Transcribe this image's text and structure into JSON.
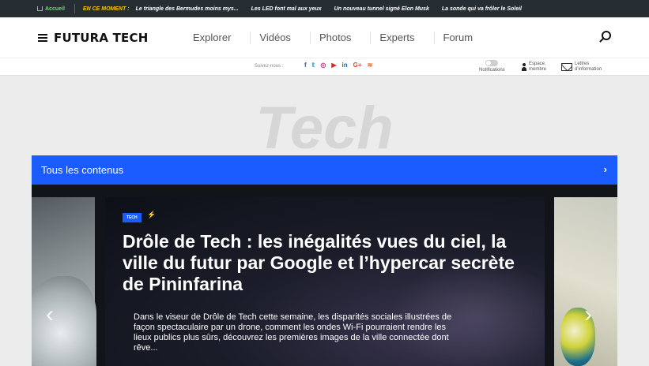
{
  "ticker": {
    "home_label": "Accueil",
    "live_label": "EN CE MOMENT :",
    "items": [
      "Le triangle des Bermudes moins mys...",
      "Les LED font mal aux yeux",
      "Un nouveau tunnel signé Elon Musk",
      "La sonde qui va frôler le Soleil"
    ]
  },
  "header": {
    "logo": "FUTURA TECH",
    "nav": [
      "Explorer",
      "Vidéos",
      "Photos",
      "Experts",
      "Forum"
    ]
  },
  "subbar": {
    "follow_label": "Suivez-nous :",
    "socials": [
      {
        "glyph": "f",
        "icon": "facebook-icon",
        "color": "#3b5998"
      },
      {
        "glyph": "𝕥",
        "icon": "twitter-icon",
        "color": "#1da1f2"
      },
      {
        "glyph": "◎",
        "icon": "instagram-icon",
        "color": "#c13584"
      },
      {
        "glyph": "▶",
        "icon": "youtube-icon",
        "color": "#e62117"
      },
      {
        "glyph": "in",
        "icon": "linkedin-icon",
        "color": "#0077b5"
      },
      {
        "glyph": "G+",
        "icon": "google-plus-icon",
        "color": "#dd4b39"
      },
      {
        "glyph": "≋",
        "icon": "rss-icon",
        "color": "#f26522"
      }
    ],
    "notifications_label": "Notifications",
    "account_line1": "Espace",
    "account_line2": "membre",
    "newsletter_line1": "Lettres",
    "newsletter_line2": "d'information"
  },
  "section": {
    "big_title": "Tech",
    "all_content_label": "Tous les contenus",
    "chevron": "›"
  },
  "carousel": {
    "tag": "TECH",
    "headline": "Drôle de Tech : les inégalités vues du ciel, la ville du futur par Google et l’hypercar secrète de Pininfarina",
    "excerpt": "Dans le viseur de Drôle de Tech cette semaine, les disparités sociales illustrées de façon spectaculaire par un drone, comment les ondes Wi-Fi pourraient rendre les lieux publics plus sûrs, découvrez les premières images de la ville connectée dont rêve...",
    "prev_glyph": "‹",
    "next_glyph": "›"
  },
  "colors": {
    "ticker_bg": "#262d33",
    "accent_blue": "#1a5cff",
    "live_yellow": "#f7c300"
  }
}
